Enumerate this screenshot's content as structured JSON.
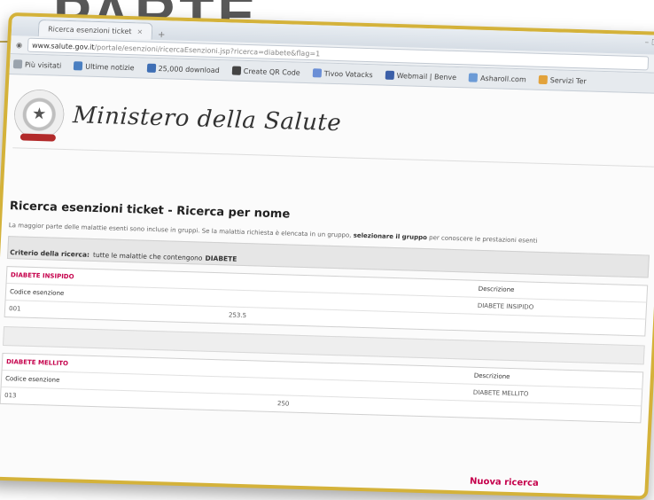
{
  "browser": {
    "tab_title": "Ricerca esenzioni ticket",
    "tab_close": "×",
    "new_tab": "+",
    "window_controls": "–  ☐",
    "url_domain": "www.salute.gov.it",
    "url_path": "/portale/esenzioni/ricercaEsenzioni.jsp?ricerca=diabete&flag=1",
    "bookmarks": [
      {
        "label": "Più visitati",
        "color": "#9aa3ad"
      },
      {
        "label": "Ultime notizie",
        "color": "#4a7fc1"
      },
      {
        "label": "25,000 download",
        "color": "#3f6fb5"
      },
      {
        "label": "Create QR Code",
        "color": "#444444"
      },
      {
        "label": "Tivoo Vatacks",
        "color": "#6b8fd6"
      },
      {
        "label": "Webmail | Benve",
        "color": "#3b5fa8"
      },
      {
        "label": "Asharoll.com",
        "color": "#6c9bd6"
      },
      {
        "label": "Servizi Ter",
        "color": "#e2a23b"
      }
    ]
  },
  "site": {
    "ministry_name": "Ministero della Salute"
  },
  "page": {
    "title": "Ricerca esenzioni ticket - Ricerca per nome",
    "intro_text": "La maggior parte delle malattie esenti sono incluse in gruppi. Se la malattia richiesta è elencata in un gruppo,",
    "intro_bold": "selezionare il gruppo",
    "intro_end": "per conoscere le prestazioni esenti",
    "criteria_label": "Criterio della ricerca:",
    "criteria_text": "tutte le malattie che contengono",
    "criteria_term": "DIABETE"
  },
  "groups": [
    {
      "name": "DIABETE INSIPIDO",
      "description_header": "Descrizione",
      "code_header": "Codice esenzione",
      "description_value": "DIABETE INSIPIDO",
      "code_value": "001",
      "icd_value": "253.5"
    },
    {
      "name": "DIABETE MELLITO",
      "description_header": "Descrizione",
      "code_header": "Codice esenzione",
      "description_value": "DIABETE MELLITO",
      "code_value": "013",
      "icd_value": "250"
    }
  ],
  "actions": {
    "new_search": "Nuova ricerca"
  }
}
